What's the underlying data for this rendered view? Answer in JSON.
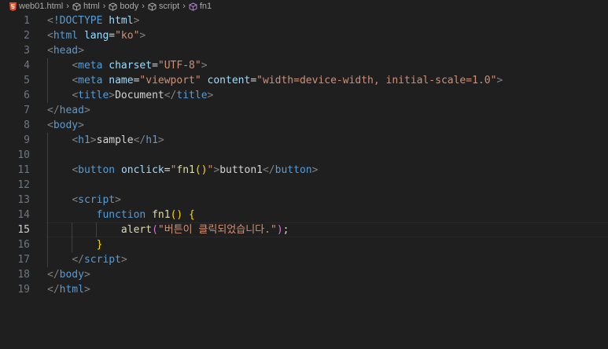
{
  "breadcrumb": {
    "file": "web01.html",
    "items": [
      "html",
      "body",
      "script",
      "fn1"
    ]
  },
  "editor": {
    "current_line": 15,
    "lines": [
      {
        "n": "1",
        "tokens": [
          [
            "t-punc",
            "<"
          ],
          [
            "t-tag",
            "!DOCTYPE"
          ],
          [
            "t-text",
            " "
          ],
          [
            "t-attr",
            "html"
          ],
          [
            "t-punc",
            ">"
          ]
        ]
      },
      {
        "n": "2",
        "tokens": [
          [
            "t-punc",
            "<"
          ],
          [
            "t-tag",
            "html"
          ],
          [
            "t-text",
            " "
          ],
          [
            "t-attr",
            "lang"
          ],
          [
            "t-eq",
            "="
          ],
          [
            "t-str",
            "\"ko\""
          ],
          [
            "t-punc",
            ">"
          ]
        ]
      },
      {
        "n": "3",
        "tokens": [
          [
            "t-punc",
            "<"
          ],
          [
            "t-tag",
            "head"
          ],
          [
            "t-punc",
            ">"
          ]
        ]
      },
      {
        "n": "4",
        "tokens": [
          [
            "t-text",
            "    "
          ],
          [
            "t-punc",
            "<"
          ],
          [
            "t-tag",
            "meta"
          ],
          [
            "t-text",
            " "
          ],
          [
            "t-attr",
            "charset"
          ],
          [
            "t-eq",
            "="
          ],
          [
            "t-str",
            "\"UTF-8\""
          ],
          [
            "t-punc",
            ">"
          ]
        ]
      },
      {
        "n": "5",
        "tokens": [
          [
            "t-text",
            "    "
          ],
          [
            "t-punc",
            "<"
          ],
          [
            "t-tag",
            "meta"
          ],
          [
            "t-text",
            " "
          ],
          [
            "t-attr",
            "name"
          ],
          [
            "t-eq",
            "="
          ],
          [
            "t-str",
            "\"viewport\""
          ],
          [
            "t-text",
            " "
          ],
          [
            "t-attr",
            "content"
          ],
          [
            "t-eq",
            "="
          ],
          [
            "t-str",
            "\"width=device-width, initial-scale=1.0\""
          ],
          [
            "t-punc",
            ">"
          ]
        ]
      },
      {
        "n": "6",
        "tokens": [
          [
            "t-text",
            "    "
          ],
          [
            "t-punc",
            "<"
          ],
          [
            "t-tag",
            "title"
          ],
          [
            "t-punc",
            ">"
          ],
          [
            "t-text",
            "Document"
          ],
          [
            "t-punc",
            "</"
          ],
          [
            "t-tag",
            "title"
          ],
          [
            "t-punc",
            ">"
          ]
        ]
      },
      {
        "n": "7",
        "tokens": [
          [
            "t-punc",
            "</"
          ],
          [
            "t-tag",
            "head"
          ],
          [
            "t-punc",
            ">"
          ]
        ]
      },
      {
        "n": "8",
        "tokens": [
          [
            "t-punc",
            "<"
          ],
          [
            "t-tag",
            "body"
          ],
          [
            "t-punc",
            ">"
          ]
        ]
      },
      {
        "n": "9",
        "tokens": [
          [
            "t-text",
            "    "
          ],
          [
            "t-punc",
            "<"
          ],
          [
            "t-tag",
            "h1"
          ],
          [
            "t-punc",
            ">"
          ],
          [
            "t-text",
            "sample"
          ],
          [
            "t-punc",
            "</"
          ],
          [
            "t-tag",
            "h1"
          ],
          [
            "t-punc",
            ">"
          ]
        ]
      },
      {
        "n": "10",
        "tokens": []
      },
      {
        "n": "11",
        "tokens": [
          [
            "t-text",
            "    "
          ],
          [
            "t-punc",
            "<"
          ],
          [
            "t-tag",
            "button"
          ],
          [
            "t-text",
            " "
          ],
          [
            "t-attr",
            "onclick"
          ],
          [
            "t-eq",
            "="
          ],
          [
            "t-str",
            "\""
          ],
          [
            "t-fn",
            "fn1"
          ],
          [
            "t-brace",
            "()"
          ],
          [
            "t-str",
            "\""
          ],
          [
            "t-punc",
            ">"
          ],
          [
            "t-text",
            "button1"
          ],
          [
            "t-punc",
            "</"
          ],
          [
            "t-tag",
            "button"
          ],
          [
            "t-punc",
            ">"
          ]
        ]
      },
      {
        "n": "12",
        "tokens": []
      },
      {
        "n": "13",
        "tokens": [
          [
            "t-text",
            "    "
          ],
          [
            "t-punc",
            "<"
          ],
          [
            "t-tag",
            "script"
          ],
          [
            "t-punc",
            ">"
          ]
        ]
      },
      {
        "n": "14",
        "tokens": [
          [
            "t-text",
            "        "
          ],
          [
            "t-kw",
            "function"
          ],
          [
            "t-text",
            " "
          ],
          [
            "t-fn",
            "fn1"
          ],
          [
            "t-brace",
            "()"
          ],
          [
            "t-text",
            " "
          ],
          [
            "t-brace",
            "{"
          ]
        ]
      },
      {
        "n": "15",
        "tokens": [
          [
            "t-text",
            "            "
          ],
          [
            "t-fn",
            "alert"
          ],
          [
            "t-brace2",
            "("
          ],
          [
            "t-str",
            "\"버튼이 클릭되었습니다.\""
          ],
          [
            "t-brace2",
            ")"
          ],
          [
            "t-text",
            ";"
          ]
        ]
      },
      {
        "n": "16",
        "tokens": [
          [
            "t-text",
            "        "
          ],
          [
            "t-brace",
            "}"
          ]
        ]
      },
      {
        "n": "17",
        "tokens": [
          [
            "t-text",
            "    "
          ],
          [
            "t-punc",
            "</"
          ],
          [
            "t-tag",
            "script"
          ],
          [
            "t-punc",
            ">"
          ]
        ]
      },
      {
        "n": "18",
        "tokens": [
          [
            "t-punc",
            "</"
          ],
          [
            "t-tag",
            "body"
          ],
          [
            "t-punc",
            ">"
          ]
        ]
      },
      {
        "n": "19",
        "tokens": [
          [
            "t-punc",
            "</"
          ],
          [
            "t-tag",
            "html"
          ],
          [
            "t-punc",
            ">"
          ]
        ]
      }
    ]
  },
  "colors": {
    "background": "#1f1f1f",
    "tag": "#569cd6",
    "attribute": "#9cdcfe",
    "string": "#ce9178",
    "function": "#dcdcaa",
    "bracket": "#ffd700",
    "bracket_nested": "#da70d6"
  }
}
